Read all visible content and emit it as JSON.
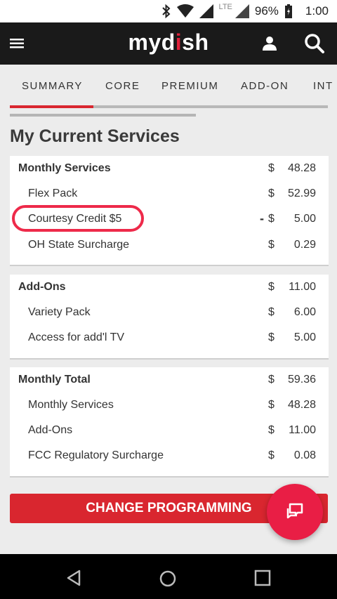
{
  "status_bar": {
    "network": "LTE",
    "battery": "96%",
    "time": "1:00"
  },
  "app_bar": {
    "logo_prefix": "myd",
    "logo_accent": "i",
    "logo_suffix": "sh",
    "brand_color": "#e0203a"
  },
  "tabs": [
    {
      "label": "SUMMARY",
      "active": true
    },
    {
      "label": "CORE",
      "active": false
    },
    {
      "label": "PREMIUM",
      "active": false
    },
    {
      "label": "ADD-ON",
      "active": false
    },
    {
      "label": "INT",
      "active": false
    }
  ],
  "page_title": "My Current Services",
  "sections": [
    {
      "header": {
        "label": "Monthly Services",
        "currency": "$",
        "amount": "48.28"
      },
      "items": [
        {
          "label": "Flex Pack",
          "sign": "",
          "currency": "$",
          "amount": "52.99"
        },
        {
          "label": "Courtesy Credit $5",
          "sign": "-",
          "currency": "$",
          "amount": "5.00"
        },
        {
          "label": "OH State Surcharge",
          "sign": "",
          "currency": "$",
          "amount": "0.29"
        }
      ]
    },
    {
      "header": {
        "label": "Add-Ons",
        "currency": "$",
        "amount": "11.00"
      },
      "items": [
        {
          "label": "Variety Pack",
          "sign": "",
          "currency": "$",
          "amount": "6.00"
        },
        {
          "label": "Access for add'l TV",
          "sign": "",
          "currency": "$",
          "amount": "5.00"
        }
      ]
    },
    {
      "header": {
        "label": "Monthly Total",
        "currency": "$",
        "amount": "59.36"
      },
      "items": [
        {
          "label": "Monthly Services",
          "sign": "",
          "currency": "$",
          "amount": "48.28"
        },
        {
          "label": "Add-Ons",
          "sign": "",
          "currency": "$",
          "amount": "11.00"
        },
        {
          "label": "FCC Regulatory Surcharge",
          "sign": "",
          "currency": "$",
          "amount": "0.08"
        }
      ]
    }
  ],
  "change_button_label": "CHANGE PROGRAMMING",
  "icons": {
    "menu": "hamburger-menu-icon",
    "user": "user-icon",
    "search": "search-icon",
    "chat": "chat-icon",
    "back": "back-triangle-icon",
    "home": "home-circle-icon",
    "recents": "recents-square-icon"
  },
  "colors": {
    "accent": "#d9262f",
    "fab": "#e91e45",
    "highlight": "#ee2a4a"
  }
}
